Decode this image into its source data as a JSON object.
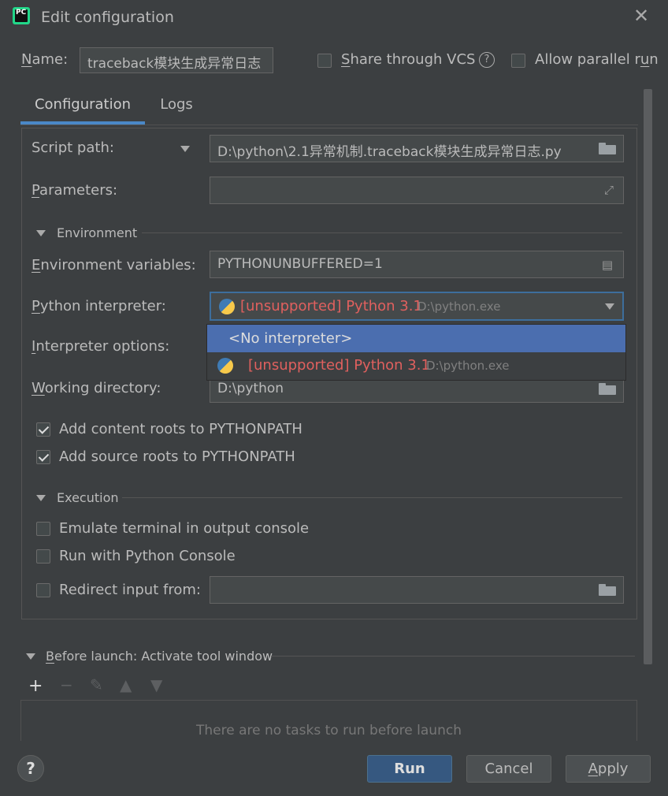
{
  "window": {
    "title": "Edit configuration",
    "logo_text": "PC"
  },
  "name_row": {
    "label_first": "N",
    "label_rest": "ame:",
    "value": "traceback模块生成异常日志",
    "share_vcs_first": "S",
    "share_vcs_rest": "hare through VCS",
    "allow_parallel_pre": "Allow parallel r",
    "allow_parallel_u": "u",
    "allow_parallel_post": "n"
  },
  "tabs": [
    {
      "label": "Configuration"
    },
    {
      "label": "Logs"
    }
  ],
  "config": {
    "script_path_label": "Script path:",
    "script_path_value": "D:\\python\\2.1异常机制.traceback模块生成异常日志.py",
    "parameters_label_first": "P",
    "parameters_label_rest": "arameters:",
    "parameters_value": "",
    "environment_section": "Environment",
    "env_vars_label_first": "E",
    "env_vars_label_rest": "nvironment variables:",
    "env_vars_value": "PYTHONUNBUFFERED=1",
    "interpreter_label_first": "P",
    "interpreter_label_rest": "ython interpreter:",
    "interpreter_selected": "[unsupported] Python 3.1",
    "interpreter_selected_path": "D:\\python.exe",
    "interpreter_options_label_first": "I",
    "interpreter_options_label_rest": "nterpreter options:",
    "dropdown_options": [
      {
        "label": "<No interpreter>"
      },
      {
        "label": "[unsupported] Python 3.1",
        "path": "D:\\python.exe"
      }
    ],
    "working_dir_label_first": "W",
    "working_dir_label_rest": "orking directory:",
    "working_dir_value": "D:\\python",
    "add_content_roots": "Add content roots to PYTHONPATH",
    "add_source_roots": "Add source roots to PYTHONPATH",
    "execution_section": "Execution",
    "emulate_terminal": "Emulate terminal in output console",
    "run_with_console": "Run with Python Console",
    "redirect_input": "Redirect input from:",
    "redirect_input_value": ""
  },
  "before_launch": {
    "title_first": "B",
    "title_rest": "efore launch: Activate tool window",
    "empty_text": "There are no tasks to run before launch"
  },
  "buttons": {
    "help": "?",
    "run": "Run",
    "cancel": "Cancel",
    "apply_first": "A",
    "apply_rest": "pply"
  }
}
